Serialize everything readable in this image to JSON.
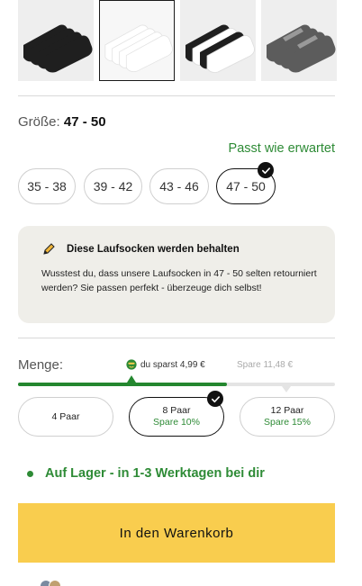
{
  "product_images": [
    {
      "name": "black-socks",
      "color": "#1f1f1f"
    },
    {
      "name": "white-socks",
      "color": "#f4f4f4"
    },
    {
      "name": "mixed-socks",
      "color": "#555555"
    },
    {
      "name": "grey-socks",
      "color": "#6a6a6a"
    }
  ],
  "size": {
    "label": "Größe:",
    "selected": "47 - 50",
    "fit_text": "Passt wie erwartet",
    "options": [
      "35 - 38",
      "39 - 42",
      "43 - 46",
      "47 - 50"
    ]
  },
  "info": {
    "title": "Diese Laufsocken werden behalten",
    "text": "Wusstest du, dass unsere Laufsocken in 47 - 50 selten retourniert werden? Sie passen perfekt - überzeuge dich selbst!"
  },
  "quantity": {
    "label": "Menge:",
    "savings_badge": "du sparst 4,99 €",
    "savings_next": "Spare 11,48 €",
    "progress_fraction": 0.66,
    "options": [
      {
        "label": "4 Paar",
        "save": ""
      },
      {
        "label": "8 Paar",
        "save": "Spare 10%"
      },
      {
        "label": "12 Paar",
        "save": "Spare 15%"
      }
    ]
  },
  "stock": {
    "text": "Auf Lager - in 1-3 Werktagen bei dir"
  },
  "cart": {
    "button_label": "In den Warenkorb"
  },
  "colors": {
    "accent_green": "#2e8b36",
    "cart_yellow": "#f9cd4e",
    "info_bg": "#efeee9"
  }
}
